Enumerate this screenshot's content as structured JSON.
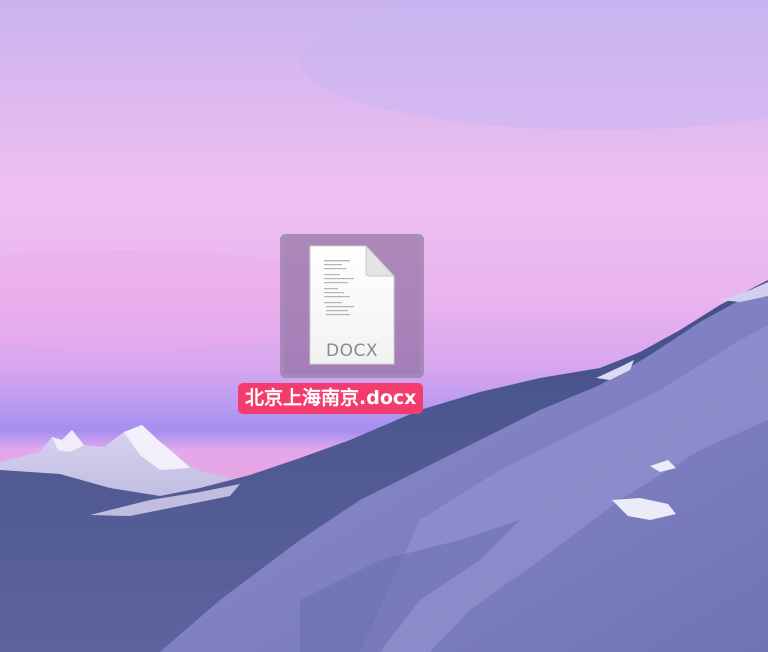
{
  "desktop": {
    "wallpaper": {
      "description_colors": {
        "sky_top": "#c9b3ee",
        "sky_mid": "#eec0f0",
        "haze": "#b99bf0",
        "mountain": "#7b7fbf",
        "snow": "#e8e2f7"
      }
    },
    "selected_file": {
      "name": "北京上海南京.docx",
      "extension_badge": "DOCX",
      "icon": "docx-document-icon",
      "selected": true,
      "label_highlight_color": "#f23c6e"
    }
  }
}
